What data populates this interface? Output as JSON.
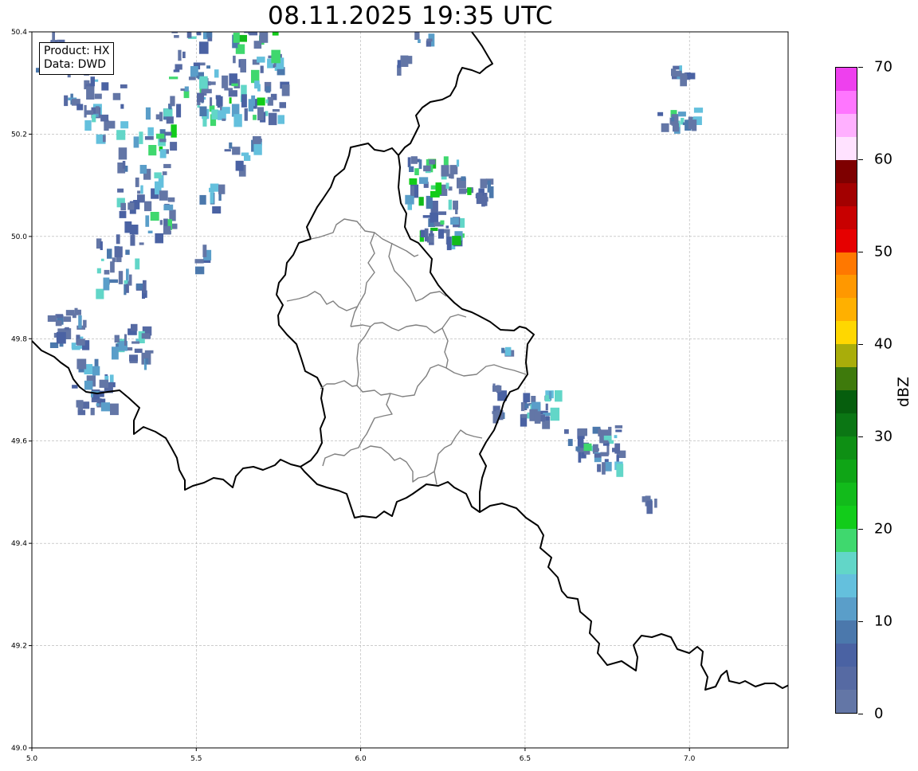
{
  "title": "08.11.2025 19:35 UTC",
  "info": {
    "product": "Product: HX",
    "data": "Data: DWD"
  },
  "axes": {
    "x_ticks": [
      "5.0",
      "5.5",
      "6.0",
      "6.5",
      "7.0"
    ],
    "y_ticks": [
      "50.4",
      "50.2",
      "50.0",
      "49.8",
      "49.6",
      "49.4",
      "49.2",
      "49.0"
    ],
    "xlim": [
      5.0,
      7.3
    ],
    "ylim": [
      49.0,
      50.4
    ],
    "grid": true
  },
  "colorbar": {
    "label": "dBZ",
    "tick_labels": [
      "0",
      "10",
      "20",
      "30",
      "40",
      "50",
      "60",
      "70"
    ],
    "range": [
      0,
      70
    ],
    "step": 2.5,
    "colors": [
      "#6376a6",
      "#566aa3",
      "#4a62a3",
      "#4b78ac",
      "#5a9ec9",
      "#64c0dd",
      "#62d6c8",
      "#3fd86e",
      "#12cc1a",
      "#12bb1b",
      "#0fa516",
      "#0e8f14",
      "#0b7614",
      "#065e0d",
      "#3e7a0c",
      "#a9ad0a",
      "#ffd700",
      "#ffb000",
      "#ff9800",
      "#ff7800",
      "#e60000",
      "#c80000",
      "#a30000",
      "#7e0000",
      "#ffe2ff",
      "#ffb0ff",
      "#ff76ff",
      "#ee40ee"
    ]
  }
}
